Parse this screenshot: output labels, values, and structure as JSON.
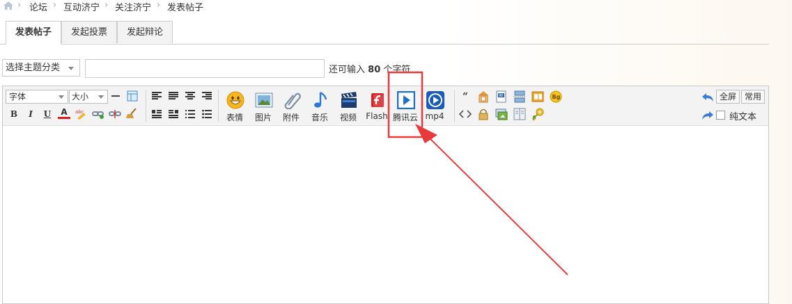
{
  "breadcrumb": [
    "论坛",
    "互动济宁",
    "关注济宁",
    "发表帖子"
  ],
  "tabs": [
    {
      "label": "发表帖子",
      "active": true
    },
    {
      "label": "发起投票",
      "active": false
    },
    {
      "label": "发起辩论",
      "active": false
    }
  ],
  "subject": {
    "type_select": "选择主题分类",
    "value": "",
    "counter_prefix": "还可输入",
    "counter_value": "80",
    "counter_suffix": "个字符"
  },
  "toolbar": {
    "font_select": "字体",
    "size_select": "大小",
    "format_buttons": [
      "B",
      "I",
      "U",
      "A"
    ],
    "big_buttons": [
      {
        "label": "表情",
        "icon": "smiley-icon"
      },
      {
        "label": "图片",
        "icon": "image-icon"
      },
      {
        "label": "附件",
        "icon": "paperclip-icon"
      },
      {
        "label": "音乐",
        "icon": "music-note-icon"
      },
      {
        "label": "视频",
        "icon": "film-clapper-icon"
      },
      {
        "label": "Flash",
        "icon": "flash-icon"
      },
      {
        "label": "腾讯云",
        "icon": "tencent-cloud-play-icon"
      },
      {
        "label": "mp4",
        "icon": "mp4-play-icon"
      }
    ],
    "fullscreen": "全屏",
    "common": "常用",
    "plain_text": "纯文本"
  },
  "colors": {
    "annotation_red": "#e83a3a",
    "tencent_blue": "#1f6fd1",
    "mp4_blue": "#1a5cb8",
    "flash_red": "#d71f26"
  }
}
